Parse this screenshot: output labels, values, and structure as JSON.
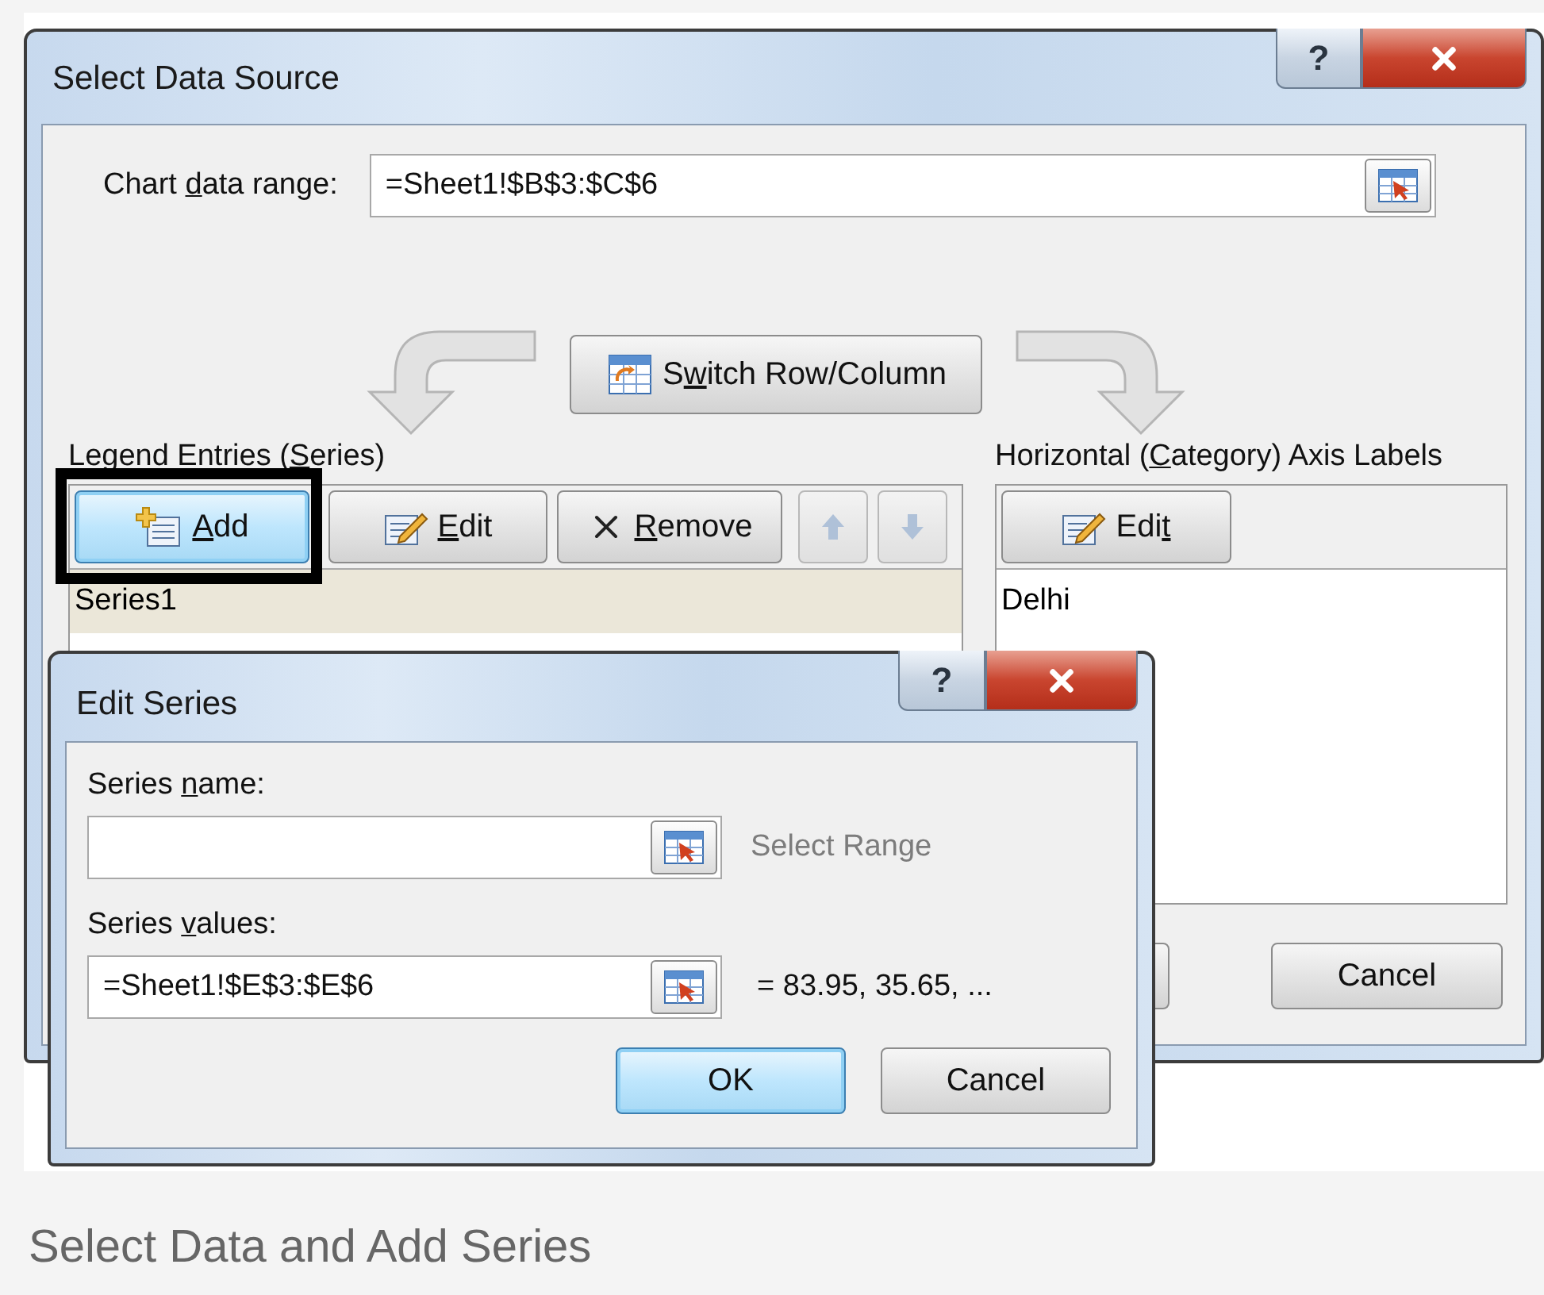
{
  "select_data_source": {
    "title": "Select Data Source",
    "help_label": "?",
    "chart_data_range": {
      "label": {
        "before": "Chart ",
        "key": "d",
        "after": "ata range:"
      },
      "value": "=Sheet1!$B$3:$C$6"
    },
    "switch_button": {
      "before": "S",
      "key": "w",
      "after": "itch Row/Column"
    },
    "legend": {
      "label": {
        "before": "Legend Entries (",
        "key": "S",
        "after": "eries)"
      },
      "buttons": [
        {
          "kind": "add",
          "label": {
            "key": "A",
            "after": "dd"
          },
          "focused": true
        },
        {
          "kind": "edit",
          "label": {
            "key": "E",
            "after": "dit"
          },
          "focused": false
        },
        {
          "kind": "remove",
          "label": {
            "key": "R",
            "after": "emove"
          },
          "focused": false
        }
      ],
      "move_buttons": [
        {
          "kind": "up",
          "disabled": true
        },
        {
          "kind": "down",
          "disabled": true
        }
      ],
      "series": [
        {
          "name": "Series1",
          "selected": true
        }
      ]
    },
    "axis": {
      "label": {
        "before": "Horizontal (",
        "key": "C",
        "after": "ategory) Axis Labels"
      },
      "edit_button": {
        "before": "Edi",
        "key": "t"
      },
      "categories": [
        "Delhi"
      ]
    },
    "cancel_label": "Cancel"
  },
  "edit_series": {
    "title": "Edit Series",
    "help_label": "?",
    "name_label": {
      "before": "Series ",
      "key": "n",
      "after": "ame:"
    },
    "name_hint": "Select Range",
    "values_label": {
      "before": "Series ",
      "key": "v",
      "after": "alues:"
    },
    "values_value": "=Sheet1!$E$3:$E$6",
    "values_preview": "= 83.95, 35.65, ...",
    "buttons": [
      {
        "label": "OK",
        "default": true
      },
      {
        "label": "Cancel",
        "default": false
      }
    ]
  },
  "caption": "Select Data and Add Series"
}
